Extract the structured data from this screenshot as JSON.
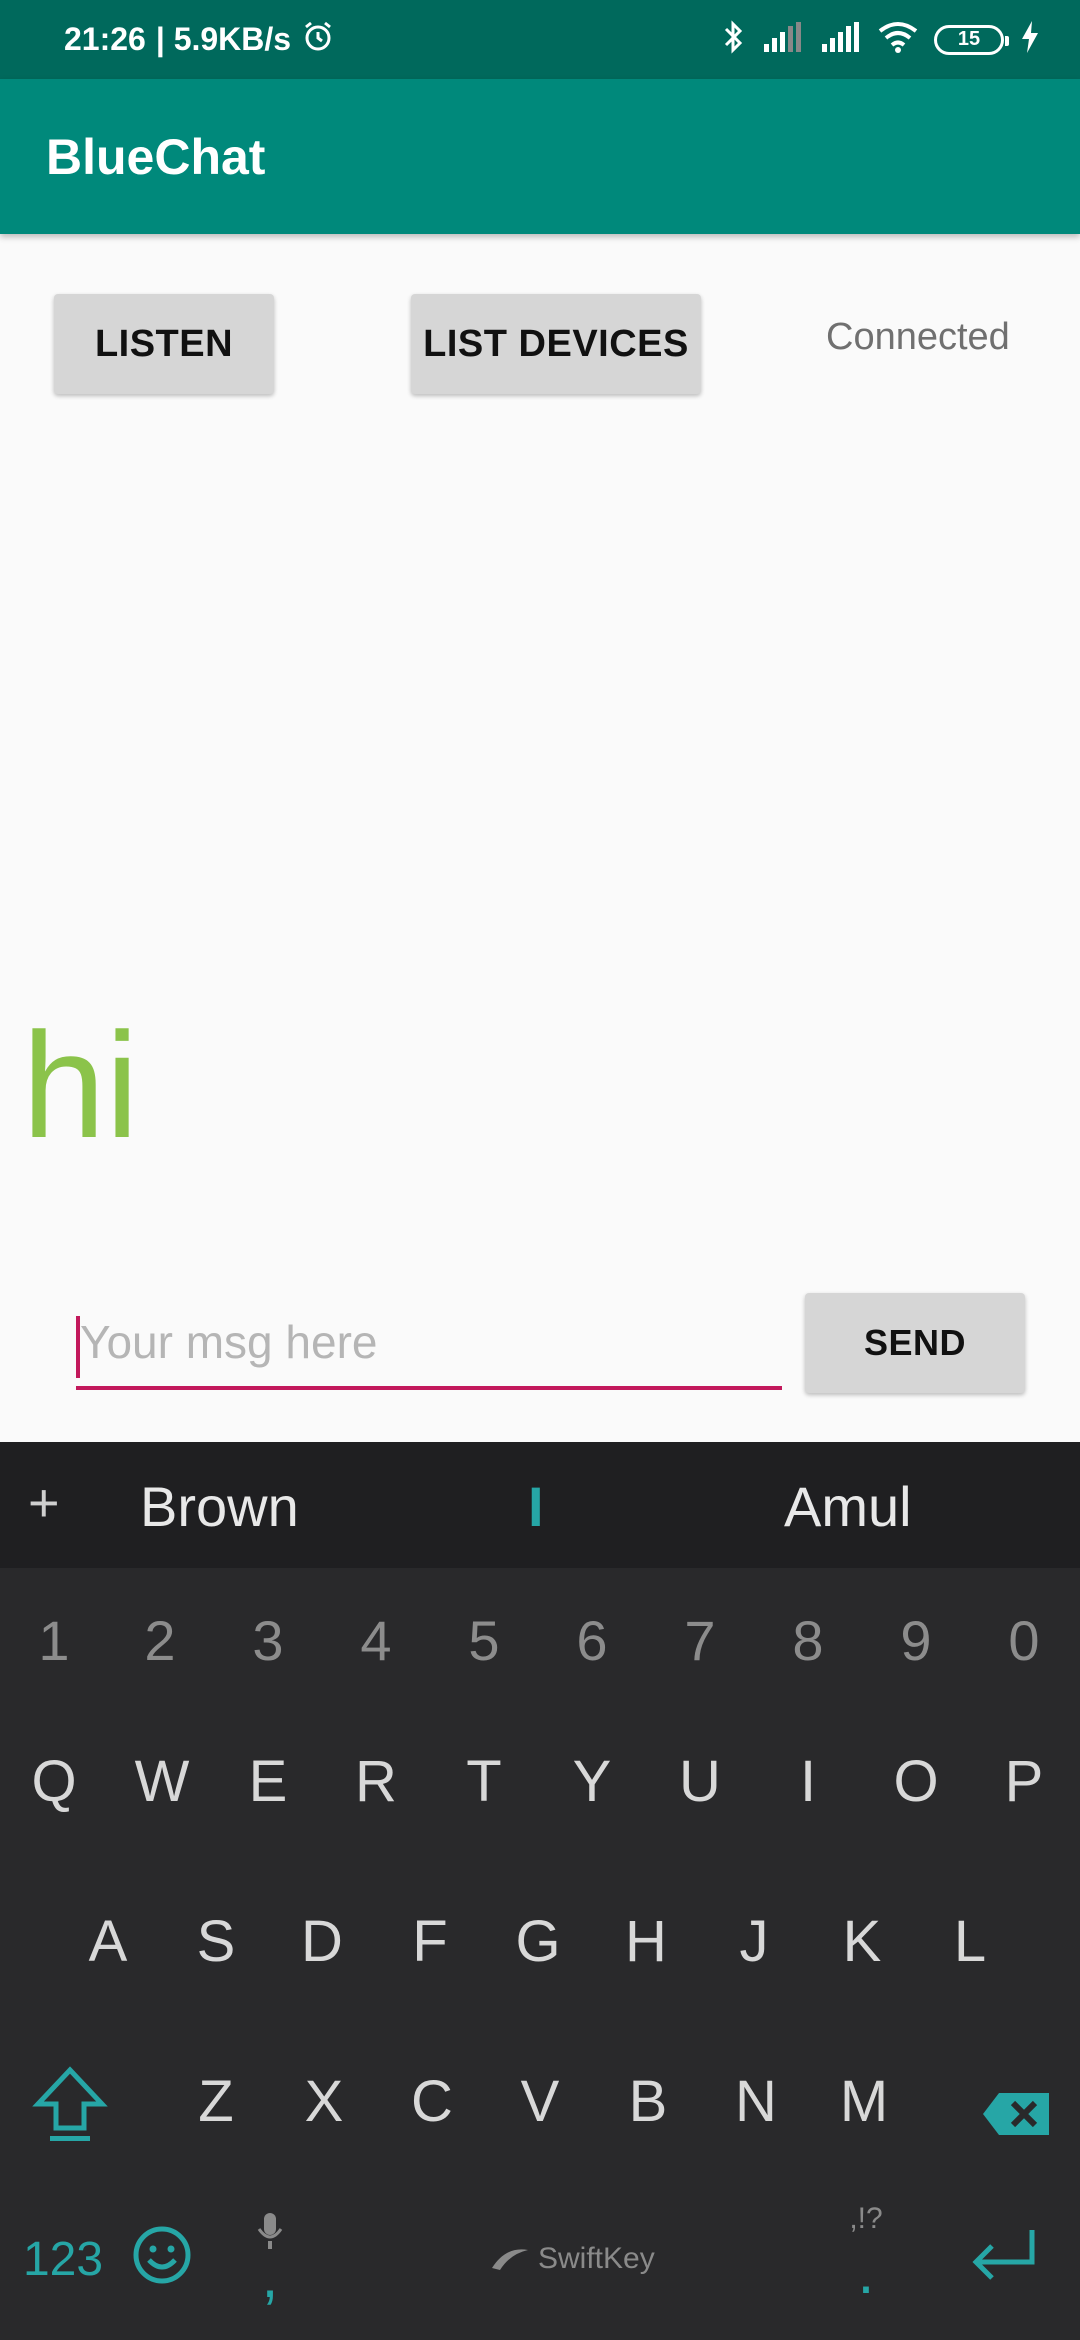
{
  "status_bar": {
    "time": "21:26",
    "speed": "| 5.9KB/s",
    "battery": "15"
  },
  "app": {
    "title": "BlueChat"
  },
  "controls": {
    "listen_label": "LISTEN",
    "list_devices_label": "LIST DEVICES",
    "connection_status": "Connected"
  },
  "chat": {
    "last_message": "hi"
  },
  "composer": {
    "value": "",
    "placeholder": "Your msg here",
    "send_label": "SEND"
  },
  "keyboard": {
    "suggestions": [
      "Brown",
      "I",
      "Amul"
    ],
    "number_row": [
      "1",
      "2",
      "3",
      "4",
      "5",
      "6",
      "7",
      "8",
      "9",
      "0"
    ],
    "row1": [
      "Q",
      "W",
      "E",
      "R",
      "T",
      "Y",
      "U",
      "I",
      "O",
      "P"
    ],
    "row2": [
      "A",
      "S",
      "D",
      "F",
      "G",
      "H",
      "J",
      "K",
      "L"
    ],
    "row3": [
      "Z",
      "X",
      "C",
      "V",
      "B",
      "N",
      "M"
    ],
    "symbols_label": "123",
    "comma": ",",
    "period": ".",
    "punct_hint": ",!?",
    "brand": "SwiftKey"
  },
  "colors": {
    "status_bar": "#00695c",
    "app_bar": "#00897b",
    "message": "#8bc34a",
    "input_accent": "#c2185b",
    "keyboard_accent": "#26a6a6"
  }
}
